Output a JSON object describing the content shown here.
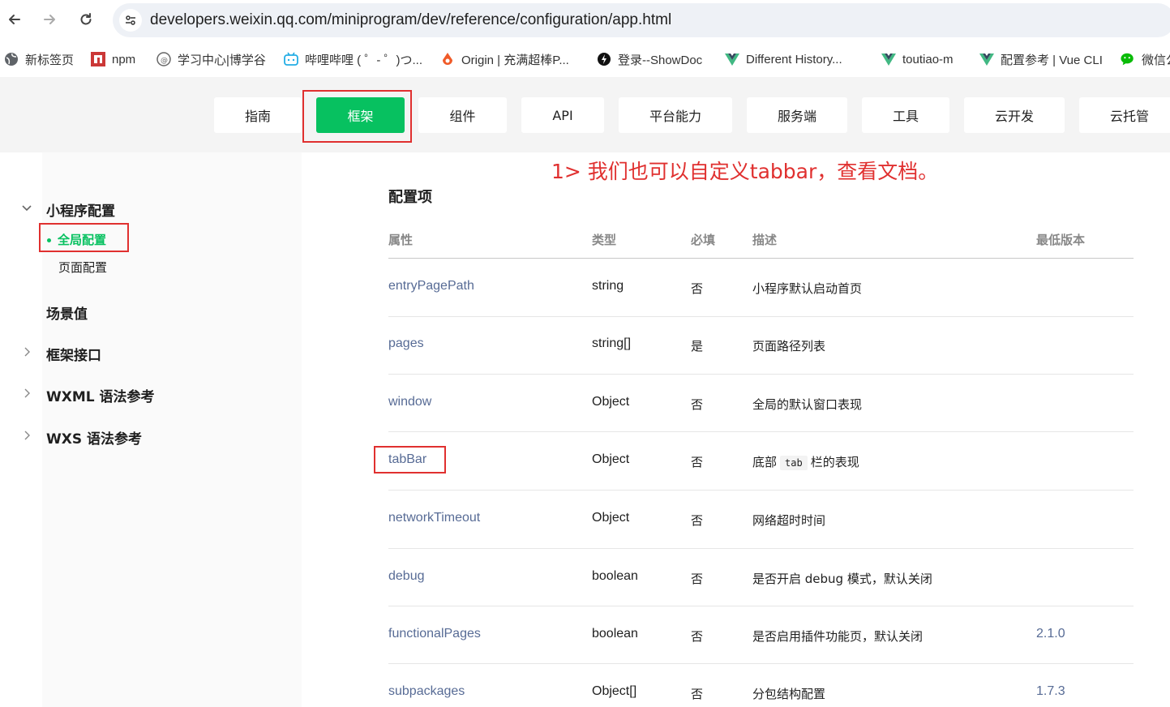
{
  "browser": {
    "url": "developers.weixin.qq.com/miniprogram/dev/reference/configuration/app.html",
    "bookmarks": [
      {
        "label": "新标签页",
        "icon": "globe-icon"
      },
      {
        "label": "npm",
        "icon": "npm-icon"
      },
      {
        "label": "学习中心|博学谷",
        "icon": "bxg-icon"
      },
      {
        "label": "哔哩哔哩 ( ゜- ゜)つ...",
        "icon": "bilibili-icon"
      },
      {
        "label": "Origin | 充满超棒P...",
        "icon": "origin-icon"
      },
      {
        "label": "登录--ShowDoc",
        "icon": "showdoc-icon"
      },
      {
        "label": "Different History...",
        "icon": "vue-icon"
      },
      {
        "label": "toutiao-m",
        "icon": "vue-icon"
      },
      {
        "label": "配置参考 | Vue CLI",
        "icon": "vue-icon"
      },
      {
        "label": "微信公",
        "icon": "wechat-icon"
      }
    ]
  },
  "topnav": {
    "tabs": [
      {
        "label": "指南"
      },
      {
        "label": "框架",
        "active": true
      },
      {
        "label": "组件"
      },
      {
        "label": "API"
      },
      {
        "label": "平台能力"
      },
      {
        "label": "服务端"
      },
      {
        "label": "工具"
      },
      {
        "label": "云开发"
      },
      {
        "label": "云托管"
      }
    ],
    "active_color": "#07c160"
  },
  "sidebar": {
    "group_title": "小程序配置",
    "sub_items": [
      "全局配置",
      "页面配置"
    ],
    "items": [
      "场景值",
      "框架接口",
      "WXML 语法参考",
      "WXS 语法参考"
    ]
  },
  "annotation": "1> 我们也可以自定义tabbar，查看文档。",
  "content": {
    "section_title": "配置项",
    "columns": [
      "属性",
      "类型",
      "必填",
      "描述",
      "最低版本"
    ],
    "rows": [
      {
        "prop": "entryPagePath",
        "type": "string",
        "required": "否",
        "desc": "小程序默认启动首页",
        "version": ""
      },
      {
        "prop": "pages",
        "type": "string[]",
        "required": "是",
        "desc": "页面路径列表",
        "version": ""
      },
      {
        "prop": "window",
        "type": "Object",
        "required": "否",
        "desc": "全局的默认窗口表现",
        "version": ""
      },
      {
        "prop": "tabBar",
        "type": "Object",
        "required": "否",
        "desc_pre": "底部",
        "desc_code": "tab",
        "desc_post": "栏的表现",
        "version": ""
      },
      {
        "prop": "networkTimeout",
        "type": "Object",
        "required": "否",
        "desc": "网络超时时间",
        "version": ""
      },
      {
        "prop": "debug",
        "type": "boolean",
        "required": "否",
        "desc": "是否开启 debug 模式，默认关闭",
        "version": ""
      },
      {
        "prop": "functionalPages",
        "type": "boolean",
        "required": "否",
        "desc": "是否启用插件功能页，默认关闭",
        "version": "2.1.0"
      },
      {
        "prop": "subpackages",
        "type": "Object[]",
        "required": "否",
        "desc": "分包结构配置",
        "version": "1.7.3"
      }
    ]
  }
}
